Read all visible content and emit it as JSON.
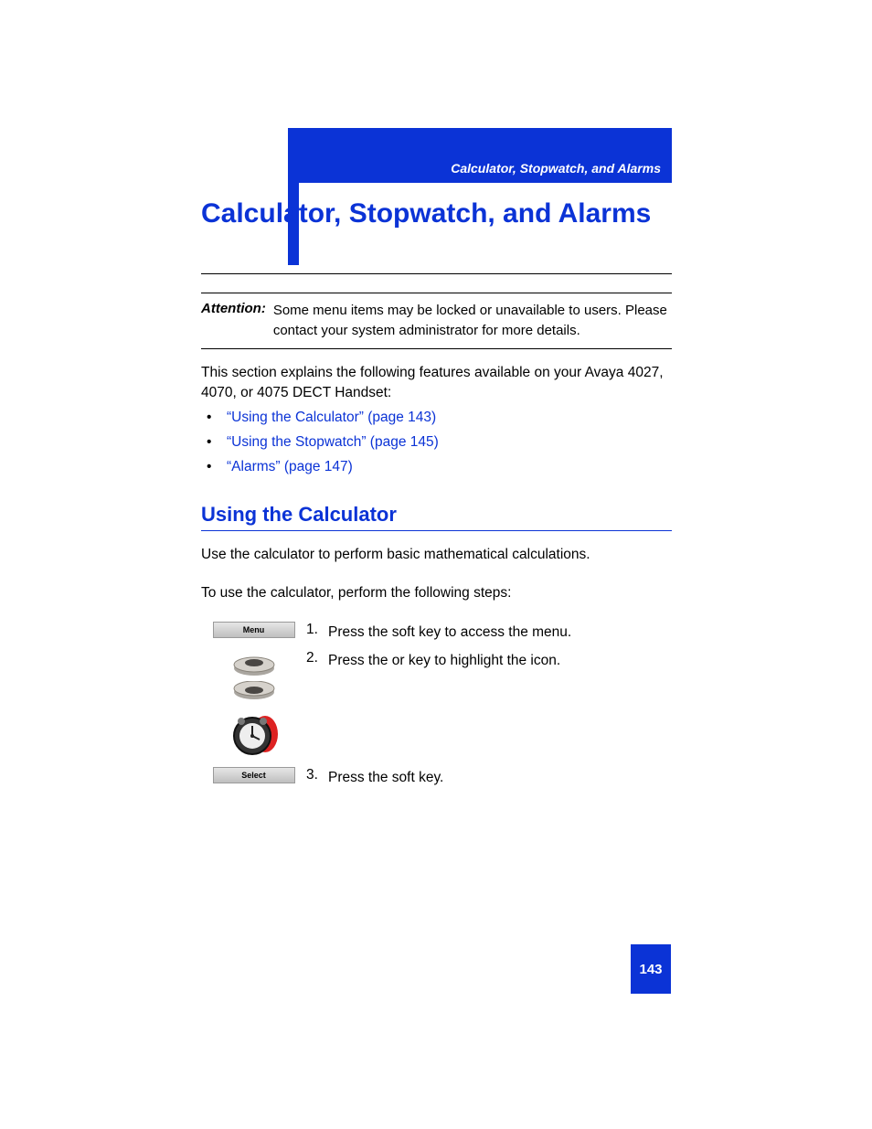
{
  "header": {
    "running_title": "Calculator, Stopwatch, and Alarms"
  },
  "title": "Calculator, Stopwatch, and Alarms",
  "attention": {
    "label": "Attention:",
    "text": "Some menu items may be locked or unavailable to users. Please contact your system administrator for more details."
  },
  "intro": "This section explains the following features available on your Avaya 4027, 4070, or 4075 DECT Handset:",
  "links": [
    "“Using the Calculator” (page 143)",
    "“Using the Stopwatch” (page 145)",
    "“Alarms” (page 147)"
  ],
  "section": {
    "heading": "Using the Calculator",
    "p1": "Use the calculator to perform basic mathematical calculations.",
    "p2": "To use the calculator, perform the following steps:"
  },
  "steps": {
    "s1": {
      "num": "1.",
      "text": "Press the        soft key to access the           menu.",
      "key_label": "Menu"
    },
    "s2": {
      "num": "2.",
      "text": "Press the     or          key to highlight the              icon."
    },
    "s3": {
      "num": "3.",
      "text": "Press the        soft key.",
      "key_label": "Select"
    }
  },
  "page_number": "143"
}
